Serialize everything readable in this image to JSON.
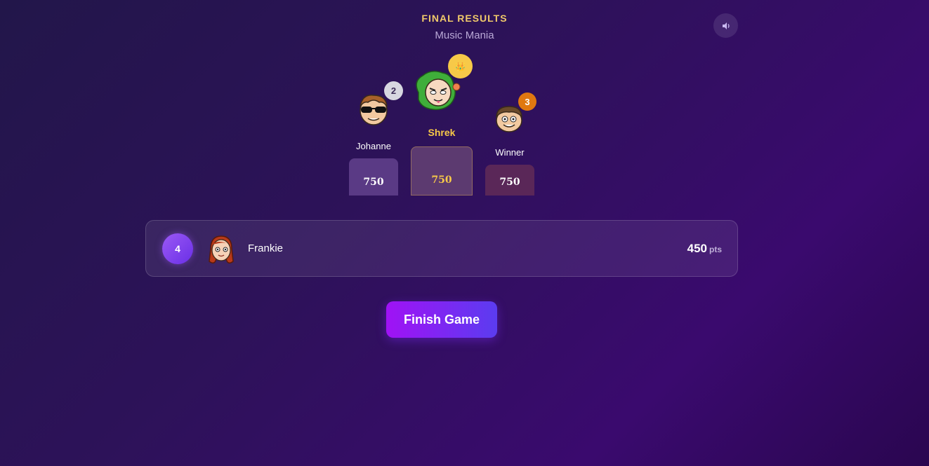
{
  "header": {
    "title": "FINAL RESULTS",
    "subtitle": "Music Mania"
  },
  "sound": {
    "icon": "speaker-icon"
  },
  "podium": {
    "first": {
      "rank": "👑",
      "name": "Shrek",
      "score": "750",
      "color": "#f7c948"
    },
    "second": {
      "rank": "2",
      "name": "Johanne",
      "score": "750",
      "color": "#d7d7e0"
    },
    "third": {
      "rank": "3",
      "name": "Winner",
      "score": "750",
      "color": "#e07810"
    }
  },
  "others": [
    {
      "rank": "4",
      "name": "Frankie",
      "score": "450",
      "unit": "pts"
    }
  ],
  "actions": {
    "finish": "Finish Game"
  }
}
